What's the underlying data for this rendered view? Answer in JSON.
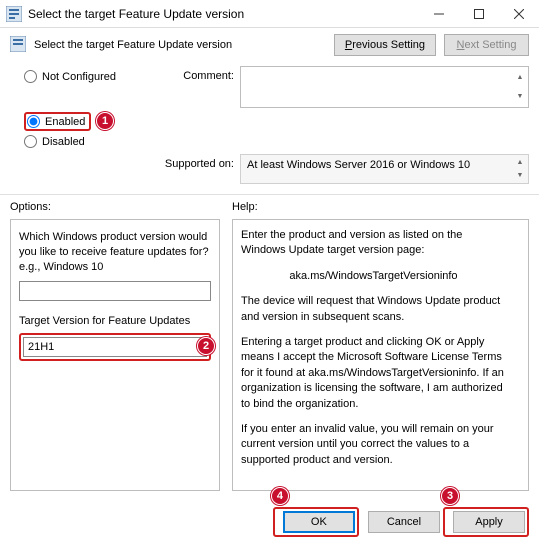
{
  "title": "Select the target Feature Update version",
  "header_title": "Select the target Feature Update version",
  "nav": {
    "prev": "Previous Setting",
    "next": "Next Setting"
  },
  "radios": {
    "not_configured": "Not Configured",
    "enabled": "Enabled",
    "disabled": "Disabled"
  },
  "labels": {
    "comment": "Comment:",
    "supported": "Supported on:"
  },
  "supported_text": "At least Windows Server 2016 or Windows 10",
  "sections": {
    "options": "Options:",
    "help": "Help:"
  },
  "options": {
    "q1": "Which Windows product version would you like to receive feature updates for? e.g., Windows 10",
    "product_value": "",
    "target_label": "Target Version for Feature Updates",
    "target_value": "21H1"
  },
  "help": {
    "p1": "Enter the product and version as listed on the Windows Update target version page:",
    "link": "aka.ms/WindowsTargetVersioninfo",
    "p2": "The device will request that Windows Update product and version in subsequent scans.",
    "p3": "Entering a target product and clicking OK or Apply means I accept the Microsoft Software License Terms for it found at aka.ms/WindowsTargetVersioninfo. If an organization is licensing the software, I am authorized to bind the organization.",
    "p4": "If you enter an invalid value, you will remain on your current version until you correct the values to a supported product and version."
  },
  "buttons": {
    "ok": "OK",
    "cancel": "Cancel",
    "apply": "Apply"
  },
  "annotations": {
    "a1": "1",
    "a2": "2",
    "a3": "3",
    "a4": "4"
  }
}
